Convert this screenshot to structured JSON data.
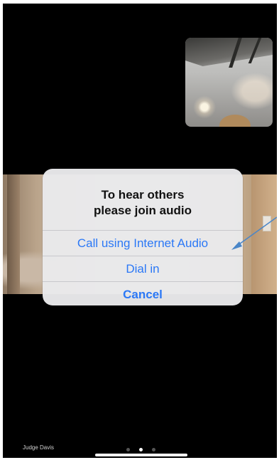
{
  "dialog": {
    "title_line1": "To hear others",
    "title_line2": "please join audio",
    "options": [
      {
        "label": "Call using Internet Audio"
      },
      {
        "label": "Dial in"
      },
      {
        "label": "Cancel"
      }
    ]
  },
  "participant": {
    "name": "Judge Davis"
  },
  "pagination": {
    "total": 3,
    "current": 2
  },
  "colors": {
    "accent": "#2b78f6",
    "annotation_arrow": "#4a86c8",
    "background": "#000000",
    "dialog_bg": "#e9e9eb"
  }
}
